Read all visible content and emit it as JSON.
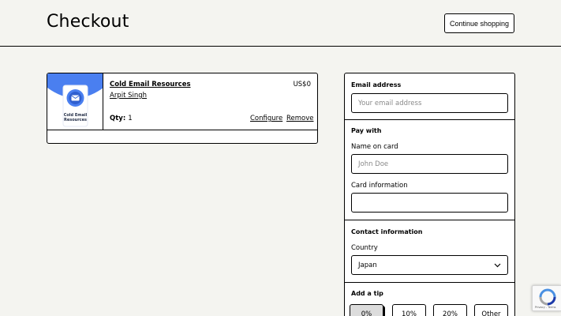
{
  "header": {
    "title": "Checkout",
    "continue_label": "Continue shopping"
  },
  "cart": {
    "items": [
      {
        "thumb_label_line1": "Cold Email",
        "thumb_label_line2": "Resources",
        "name": "Cold Email Resources",
        "seller": "Arpit Singh",
        "qty_label": "Qty:",
        "qty_value": "1",
        "price": "US$0",
        "configure_label": "Configure",
        "remove_label": "Remove"
      }
    ]
  },
  "form": {
    "email": {
      "label": "Email address",
      "placeholder": "Your email address"
    },
    "pay": {
      "title": "Pay with",
      "name_label": "Name on card",
      "name_placeholder": "John Doe",
      "card_label": "Card information",
      "card_value": ""
    },
    "contact": {
      "title": "Contact information",
      "country_label": "Country",
      "country_value": "Japan"
    },
    "tip": {
      "title": "Add a tip",
      "options": [
        "0%",
        "10%",
        "20%",
        "Other"
      ],
      "selected_index": 0
    }
  },
  "recaptcha": {
    "text": "Privacy - Terms"
  },
  "colors": {
    "thumb_blue": "#4a7ff0",
    "page_bg": "#f4f4f0"
  },
  "icons": {
    "thumb": "mail-icon",
    "select": "chevron-down-icon",
    "recaptcha": "recaptcha-logo-icon"
  }
}
